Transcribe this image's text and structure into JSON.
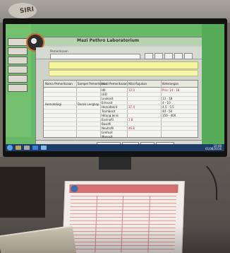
{
  "app": {
    "title": "Mazi Pethro Laboratorium"
  },
  "toolbar": {
    "search_label": "Pemeriksaan"
  },
  "table": {
    "headers": [
      "Nama Pemeriksaan",
      "Sampel Pemeriksaan",
      "Hasil Pemeriksaan",
      "Nilai Rujukan",
      "Keterangan"
    ],
    "left_labels": [
      "Hematologi",
      "Darah Lengkap"
    ],
    "rows": [
      [
        "Hb",
        "12.3"
      ],
      [
        "LED",
        ""
      ],
      [
        "Leukosit",
        ""
      ],
      [
        "Eritrosit",
        ""
      ],
      [
        "Hematokrit",
        "37.4"
      ],
      [
        "Trombosit",
        ""
      ],
      [
        "Hitung Jenis",
        ""
      ],
      [
        "Eosinofil",
        "1.8"
      ],
      [
        "Basofil",
        ""
      ],
      [
        "Neutrofil",
        "46.8"
      ],
      [
        "Limfosit",
        ""
      ],
      [
        "Monosit",
        ""
      ]
    ],
    "reference_ranges": [
      "Pria: 14 - 18",
      "13 - 18",
      "4 - 10",
      "4.5 - 5.5",
      "40 - 50",
      "150 - 400"
    ]
  },
  "bottom_bar": {
    "buttons": [
      "Simpan",
      "Cetak",
      "Batal",
      "Keluar"
    ]
  },
  "taskbar": {
    "time": "10:48",
    "date": "01/08/2016"
  },
  "book": {
    "text": "SIRI"
  },
  "colors": {
    "screen_bg": "#67b867",
    "title_bar": "#b7d2b0",
    "input_highlight": "#f4f59d",
    "taskbar": "#1d3d66"
  }
}
